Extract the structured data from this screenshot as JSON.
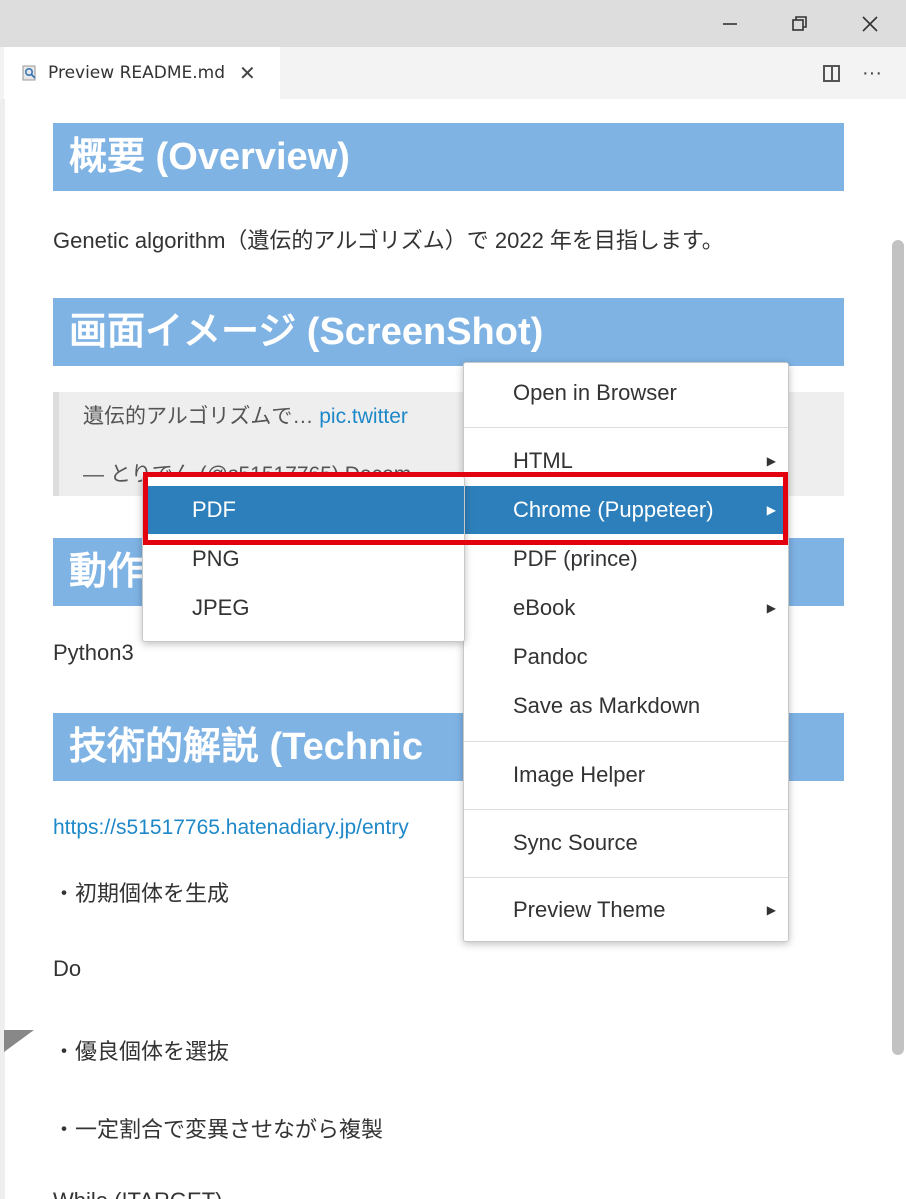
{
  "window": {
    "minimize_icon": "minimize-icon",
    "restore_icon": "restore-icon",
    "close_icon": "close-icon"
  },
  "tab": {
    "label": "Preview README.md",
    "close": "✕",
    "icon": "preview-icon"
  },
  "editor_actions": {
    "split_icon": "split-editor-icon",
    "more": "···"
  },
  "document": {
    "heading_overview": "概要 (Overview)",
    "paragraph_overview": "Genetic algorithm（遺伝的アルゴリズム）で 2022 年を目指します。",
    "heading_screenshot": "画面イメージ (ScreenShot)",
    "quote_line1_text": "遺伝的アルゴリズムで… ",
    "quote_line1_link": "pic.twitter",
    "quote_line2": "— とりでん (@s51517765) Decem",
    "heading_environment": "動作",
    "paragraph_python": "Python3",
    "heading_technical": "技術的解説 (Technic",
    "link_blog": "https://s51517765.hatenadiary.jp/entry",
    "step_init": "・初期個体を生成",
    "step_do": "Do",
    "step_select": "・優良個体を選抜",
    "step_copy": "・一定割合で変異させながら複製",
    "step_while": "While (!TARGET)"
  },
  "context_menu": {
    "items": [
      {
        "label": "Open in Browser"
      },
      {
        "label": "HTML",
        "submenu": true
      },
      {
        "label": "Chrome (Puppeteer)",
        "submenu": true,
        "active": true
      },
      {
        "label": "PDF (prince)"
      },
      {
        "label": "eBook",
        "submenu": true
      },
      {
        "label": "Pandoc"
      },
      {
        "label": "Save as Markdown"
      },
      {
        "label": "Image Helper"
      },
      {
        "label": "Sync Source"
      },
      {
        "label": "Preview Theme",
        "submenu": true
      }
    ],
    "submenu_arrow": "▶"
  },
  "sub_menu": {
    "items": [
      {
        "label": "PDF",
        "active": true
      },
      {
        "label": "PNG"
      },
      {
        "label": "JPEG"
      }
    ]
  },
  "colors": {
    "heading_bg": "#7fb3e4",
    "menu_active": "#2d7fbb",
    "highlight_border": "#e3000f",
    "link": "#1e88c9"
  }
}
